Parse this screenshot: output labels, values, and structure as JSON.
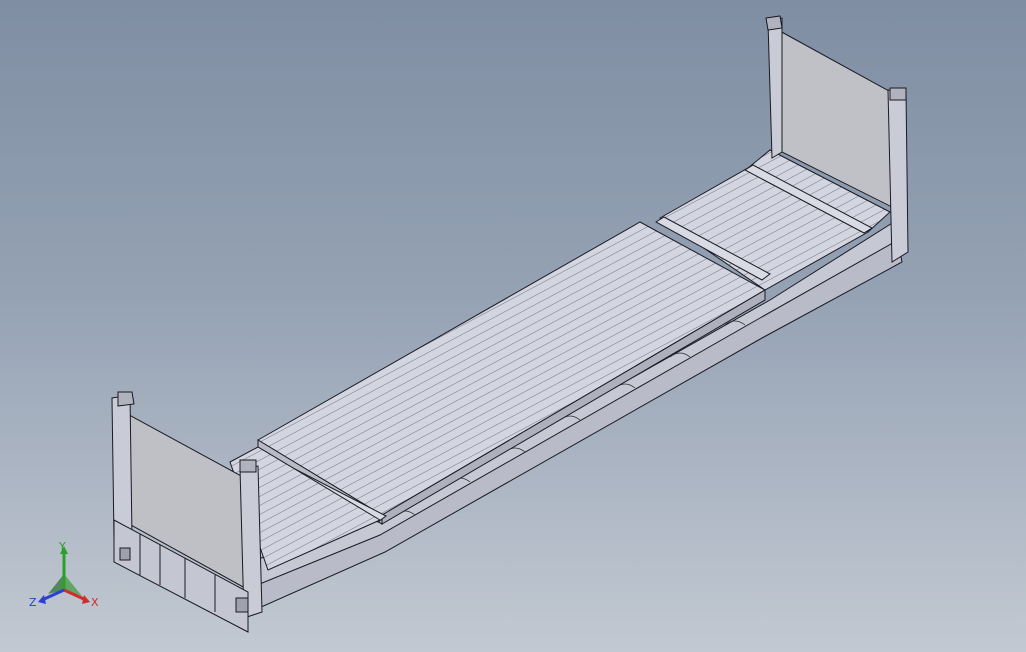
{
  "triad": {
    "x_label": "X",
    "y_label": "Y",
    "z_label": "Z"
  },
  "colors": {
    "background_top": "#7f8ea3",
    "background_bottom": "#c2c9d2",
    "model_face": "#c9cbd8",
    "model_top": "#d4d6e2",
    "model_edge": "#1a1a22",
    "panel_face": "#bfc0c6",
    "x_axis": "#d12b2b",
    "y_axis": "#2aa02a",
    "z_axis": "#2b3fd1"
  }
}
